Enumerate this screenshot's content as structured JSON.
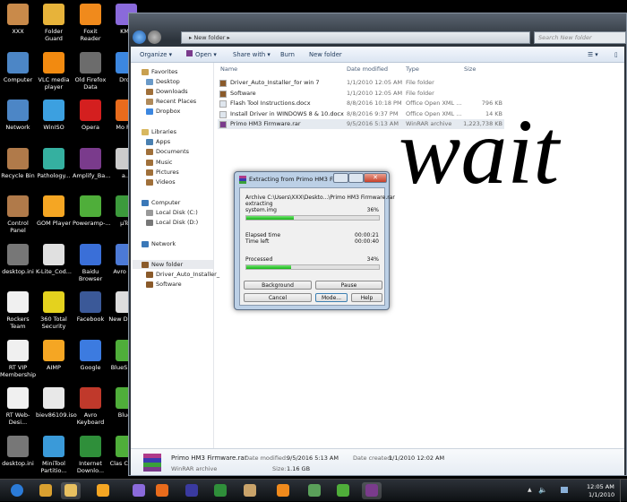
{
  "desktop": {
    "icons": [
      {
        "label": "XXX",
        "color": "#c98a4a"
      },
      {
        "label": "Folder Guard",
        "color": "#e7b33a"
      },
      {
        "label": "Foxit Reader",
        "color": "#f08a1c"
      },
      {
        "label": "KMP",
        "color": "#8a6adb"
      },
      {
        "label": "Computer",
        "color": "#4c86c6"
      },
      {
        "label": "VLC media player",
        "color": "#f28a10"
      },
      {
        "label": "Old Firefox Data",
        "color": "#6c6c6c"
      },
      {
        "label": "Drop",
        "color": "#3c87e0"
      },
      {
        "label": "Network",
        "color": "#4c86c6"
      },
      {
        "label": "WinISO",
        "color": "#3ca0e0"
      },
      {
        "label": "Opera",
        "color": "#d41f1f"
      },
      {
        "label": "Mo Fire",
        "color": "#e86b1c"
      },
      {
        "label": "Recycle Bin",
        "color": "#b07a4a"
      },
      {
        "label": "Pathology...",
        "color": "#35b0a0"
      },
      {
        "label": "Amplify_Ba...",
        "color": "#7a3b8c"
      },
      {
        "label": "a...",
        "color": "#cccccc"
      },
      {
        "label": "Control Panel",
        "color": "#b07a4a"
      },
      {
        "label": "GOM Player",
        "color": "#f5a623"
      },
      {
        "label": "Poweramp-...",
        "color": "#4fae3a"
      },
      {
        "label": "µTor",
        "color": "#3c9a3c"
      },
      {
        "label": "desktop.ini",
        "color": "#777777"
      },
      {
        "label": "K-Lite_Cod...",
        "color": "#e0e0e0"
      },
      {
        "label": "Baidu Browser",
        "color": "#3a6fd8"
      },
      {
        "label": "Avro Che",
        "color": "#4c7ad6"
      },
      {
        "label": "Rockers Team",
        "color": "#f0f0f0"
      },
      {
        "label": "360 Total Security",
        "color": "#e4d21e"
      },
      {
        "label": "Facebook",
        "color": "#3b5998"
      },
      {
        "label": "New Docum",
        "color": "#dddddd"
      },
      {
        "label": "RT VIP Membership",
        "color": "#f0f0f0"
      },
      {
        "label": "AIMP",
        "color": "#f5a623"
      },
      {
        "label": "Google",
        "color": "#3c7be0"
      },
      {
        "label": "BlueS stop",
        "color": "#4fae3a"
      },
      {
        "label": "RT Web-Desi...",
        "color": "#f0f0f0"
      },
      {
        "label": "biev86109.iso",
        "color": "#e8e8e8"
      },
      {
        "label": "Avro Keyboard",
        "color": "#c0392b"
      },
      {
        "label": "BlueS",
        "color": "#4fae3a"
      },
      {
        "label": "desktop.ini",
        "color": "#777777"
      },
      {
        "label": "MiniTool Partitio...",
        "color": "#3a9ad9"
      },
      {
        "label": "Internet Downlo...",
        "color": "#2f8f3a"
      },
      {
        "label": "Clas Clans_",
        "color": "#4fae3a"
      }
    ]
  },
  "explorer": {
    "breadcrumb": "New folder",
    "search_placeholder": "Search New folder",
    "toolbar": {
      "organize": "Organize ▾",
      "open": "Open ▾",
      "share": "Share with ▾",
      "burn": "Burn",
      "new_folder": "New folder"
    },
    "nav": {
      "favorites": "Favorites",
      "desktop": "Desktop",
      "downloads": "Downloads",
      "recent": "Recent Places",
      "dropbox": "Dropbox",
      "libraries": "Libraries",
      "apps": "Apps",
      "documents": "Documents",
      "music": "Music",
      "pictures": "Pictures",
      "videos": "Videos",
      "computer": "Computer",
      "c": "Local Disk (C:)",
      "d": "Local Disk (D:)",
      "network": "Network",
      "new_folder": "New folder",
      "sub1": "Driver_Auto_Installer_",
      "sub2": "Software"
    },
    "columns": {
      "name": "Name",
      "date": "Date modified",
      "type": "Type",
      "size": "Size"
    },
    "files": [
      {
        "name": "Driver_Auto_Installer_for win 7",
        "date": "1/1/2010 12:05 AM",
        "type": "File folder",
        "size": "",
        "icon": "folder"
      },
      {
        "name": "Software",
        "date": "1/1/2010 12:05 AM",
        "type": "File folder",
        "size": "",
        "icon": "folder"
      },
      {
        "name": "Flash Tool Instructions.docx",
        "date": "8/8/2016 10:18 PM",
        "type": "Office Open XML ...",
        "size": "796 KB",
        "icon": "doc"
      },
      {
        "name": "Install Driver in WINDOWS 8 & 10.docx",
        "date": "8/8/2016 9:37 PM",
        "type": "Office Open XML ...",
        "size": "14 KB",
        "icon": "doc"
      },
      {
        "name": "Primo HM3 Firmware.rar",
        "date": "9/5/2016 5:13 AM",
        "type": "WinRAR archive",
        "size": "1,223,738 KB",
        "icon": "rar",
        "selected": true
      }
    ],
    "details": {
      "name": "Primo HM3 Firmware.rar",
      "type": "WinRAR archive",
      "modified_label": "Date modified:",
      "modified": "9/5/2016 5:13 AM",
      "size_label": "Size:",
      "size": "1.16 GB",
      "created_label": "Date created:",
      "created": "1/1/2010 12:02 AM"
    }
  },
  "overlay_text": "wait",
  "dialog": {
    "title": "Extracting from Primo HM3 Fir...",
    "archive": "Archive C:\\Users\\XXX\\Deskto...\\Primo HM3 Firmware.rar",
    "action": "extracting",
    "file": "system.img",
    "file_percent": "36%",
    "file_progress": 36,
    "elapsed_label": "Elapsed time",
    "elapsed": "00:00:21",
    "left_label": "Time left",
    "left": "00:00:40",
    "processed_label": "Processed",
    "processed_percent": "34%",
    "processed_progress": 34,
    "buttons": {
      "background": "Background",
      "pause": "Pause",
      "cancel": "Cancel",
      "mode": "Mode...",
      "help": "Help"
    }
  },
  "taskbar": {
    "apps": [
      {
        "name": "start",
        "color": "#2b7bd8"
      },
      {
        "name": "folder-guard",
        "color": "#d9a030"
      },
      {
        "name": "explorer",
        "color": "#e8c060"
      },
      {
        "name": "gom",
        "color": "#f5a623"
      },
      {
        "name": "kmp",
        "color": "#8a6adb"
      },
      {
        "name": "firefox",
        "color": "#e86b1c"
      },
      {
        "name": "winrar-app",
        "color": "#3a3aa0"
      },
      {
        "name": "idm",
        "color": "#2f8f3a"
      },
      {
        "name": "paint",
        "color": "#c9a36a"
      },
      {
        "name": "foxit",
        "color": "#f08a1c"
      },
      {
        "name": "monitor",
        "color": "#5aa05a"
      },
      {
        "name": "bluestacks",
        "color": "#4fae3a"
      },
      {
        "name": "winrar",
        "color": "#7a3b8c"
      }
    ],
    "time": "12:05 AM",
    "date": "1/1/2010"
  }
}
